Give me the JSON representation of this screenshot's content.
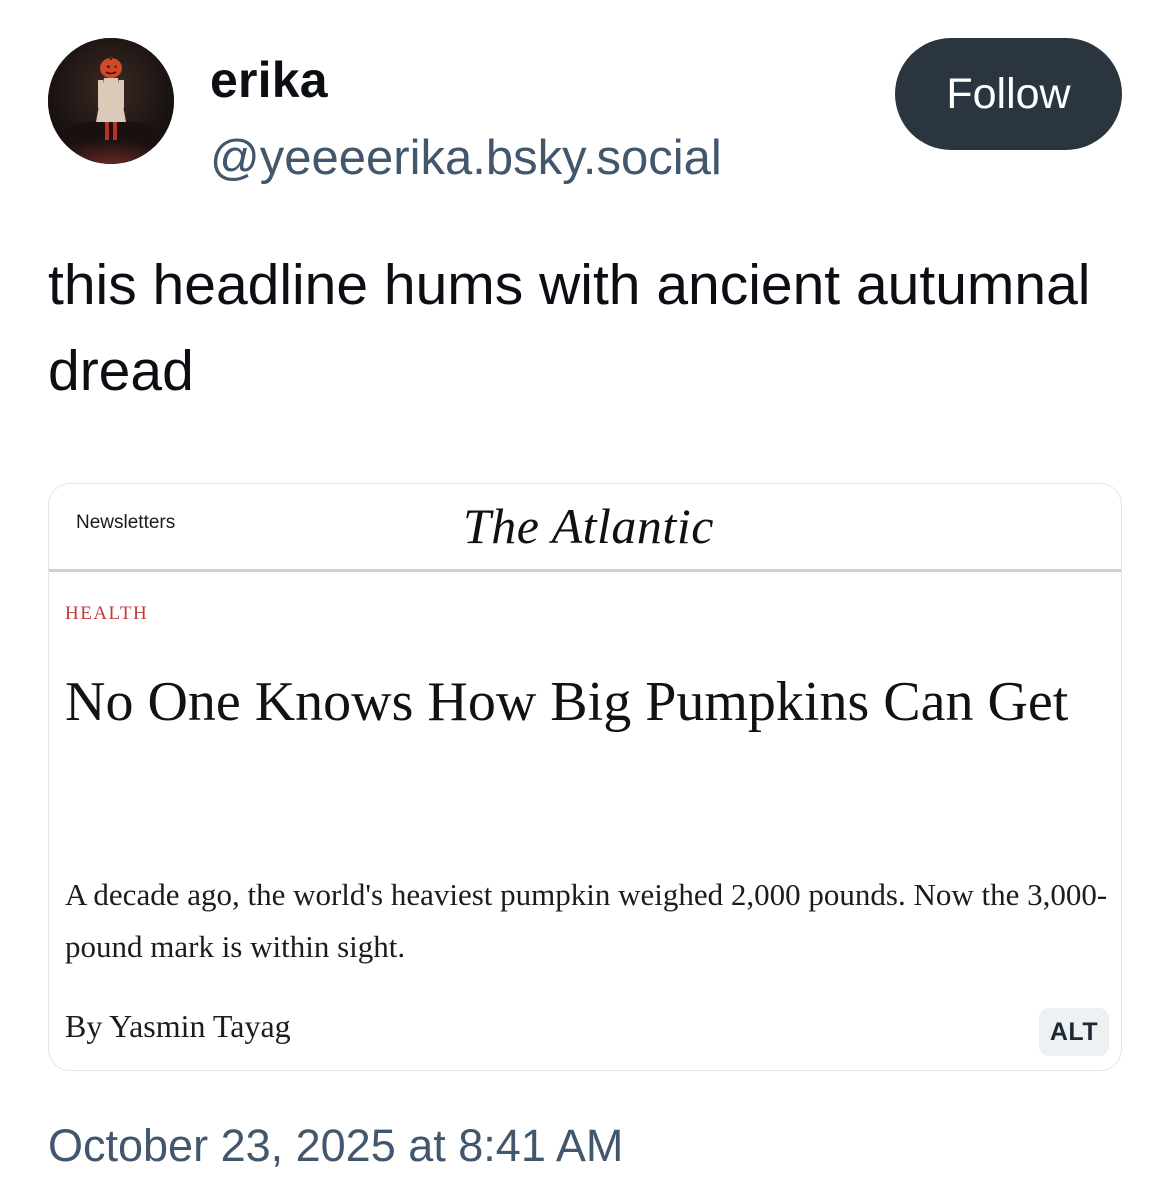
{
  "author": {
    "display_name": "erika",
    "handle": "@yeeeerika.bsky.social",
    "avatar_icon": "avatar-photo"
  },
  "follow_button": {
    "label": "Follow",
    "background": "#2a3540",
    "text_color": "#ffffff"
  },
  "post": {
    "text": "this headline hums with ancient autumnal dread",
    "timestamp": "October 23, 2025 at 8:41 AM"
  },
  "embed_image": {
    "publication": "The Atlantic",
    "nav_link": "Newsletters",
    "section": "HEALTH",
    "headline": "No One Knows How Big Pumpkins Can Get",
    "dek": "A decade ago, the world's heaviest pumpkin weighed 2,000 pounds. Now the 3,000-pound mark is within sight.",
    "byline": "By Yasmin Tayag",
    "section_color": "#c23a3a",
    "alt_badge": "ALT"
  },
  "colors": {
    "text_primary": "#0b0f14",
    "text_secondary": "#42576c",
    "card_border": "#dfe4ea"
  }
}
